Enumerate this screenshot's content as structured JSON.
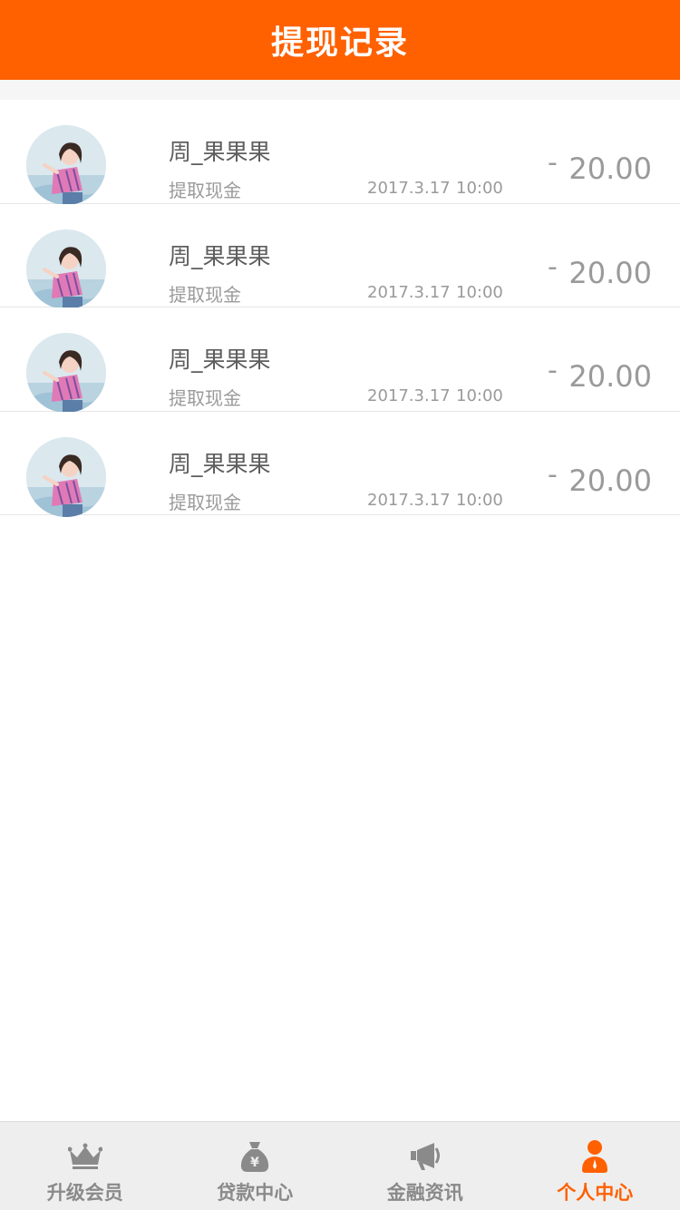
{
  "header": {
    "title": "提现记录"
  },
  "records": [
    {
      "name": "周_果果果",
      "type": "提取现金",
      "date": "2017.3.17",
      "time": "10:00",
      "sign": "-",
      "amount": "20.00"
    },
    {
      "name": "周_果果果",
      "type": "提取现金",
      "date": "2017.3.17",
      "time": "10:00",
      "sign": "-",
      "amount": "20.00"
    },
    {
      "name": "周_果果果",
      "type": "提取现金",
      "date": "2017.3.17",
      "time": "10:00",
      "sign": "-",
      "amount": "20.00"
    },
    {
      "name": "周_果果果",
      "type": "提取现金",
      "date": "2017.3.17",
      "time": "10:00",
      "sign": "-",
      "amount": "20.00"
    }
  ],
  "tabs": [
    {
      "label": "升级会员",
      "icon": "crown-icon"
    },
    {
      "label": "贷款中心",
      "icon": "money-bag-icon"
    },
    {
      "label": "金融资讯",
      "icon": "megaphone-icon"
    },
    {
      "label": "个人中心",
      "icon": "person-icon",
      "active": true
    }
  ],
  "colors": {
    "accent": "#ff6000",
    "text_secondary": "#9a9a9a",
    "tab_inactive": "#8a8a8a"
  }
}
